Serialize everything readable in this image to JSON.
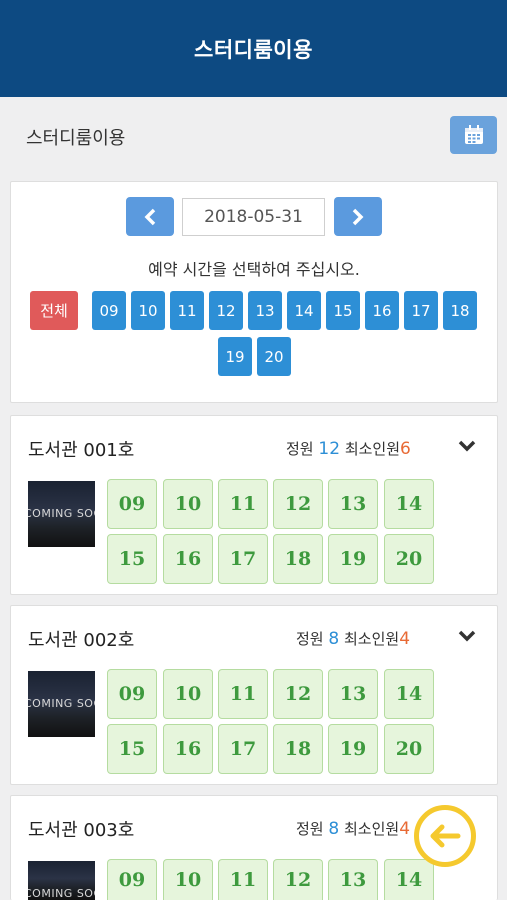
{
  "header": {
    "title": "스터디룸이용"
  },
  "subheader": {
    "label": "스터디룸이용",
    "calendar_icon": "calendar-icon"
  },
  "date_picker": {
    "prev_icon": "chevron-left-icon",
    "next_icon": "chevron-right-icon",
    "date": "2018-05-31",
    "instruction": "예약 시간을 선택하여 주십시오."
  },
  "hour_filter": {
    "all_label": "전체",
    "hours": [
      "09",
      "10",
      "11",
      "12",
      "13",
      "14",
      "15",
      "16",
      "17",
      "18",
      "19",
      "20"
    ]
  },
  "rooms": [
    {
      "name": "도서관 001호",
      "capacity_label": "정원",
      "capacity": "12",
      "min_label": "최소인원",
      "min": "6",
      "thumb_text": "COMING SOON",
      "slots": [
        "09",
        "10",
        "11",
        "12",
        "13",
        "14",
        "15",
        "16",
        "17",
        "18",
        "19",
        "20"
      ]
    },
    {
      "name": "도서관 002호",
      "capacity_label": "정원",
      "capacity": "8",
      "min_label": "최소인원",
      "min": "4",
      "thumb_text": "COMING SOON",
      "slots": [
        "09",
        "10",
        "11",
        "12",
        "13",
        "14",
        "15",
        "16",
        "17",
        "18",
        "19",
        "20"
      ]
    },
    {
      "name": "도서관 003호",
      "capacity_label": "정원",
      "capacity": "8",
      "min_label": "최소인원",
      "min": "4",
      "thumb_text": "COMING SOON",
      "slots": [
        "09",
        "10",
        "11",
        "12",
        "13",
        "14"
      ]
    }
  ],
  "colors": {
    "header_bg": "#0d4a82",
    "nav_blue": "#5b9ade",
    "hour_blue": "#2d8fd6",
    "all_red": "#e05a5a",
    "slot_green": "#3e9a3e"
  }
}
